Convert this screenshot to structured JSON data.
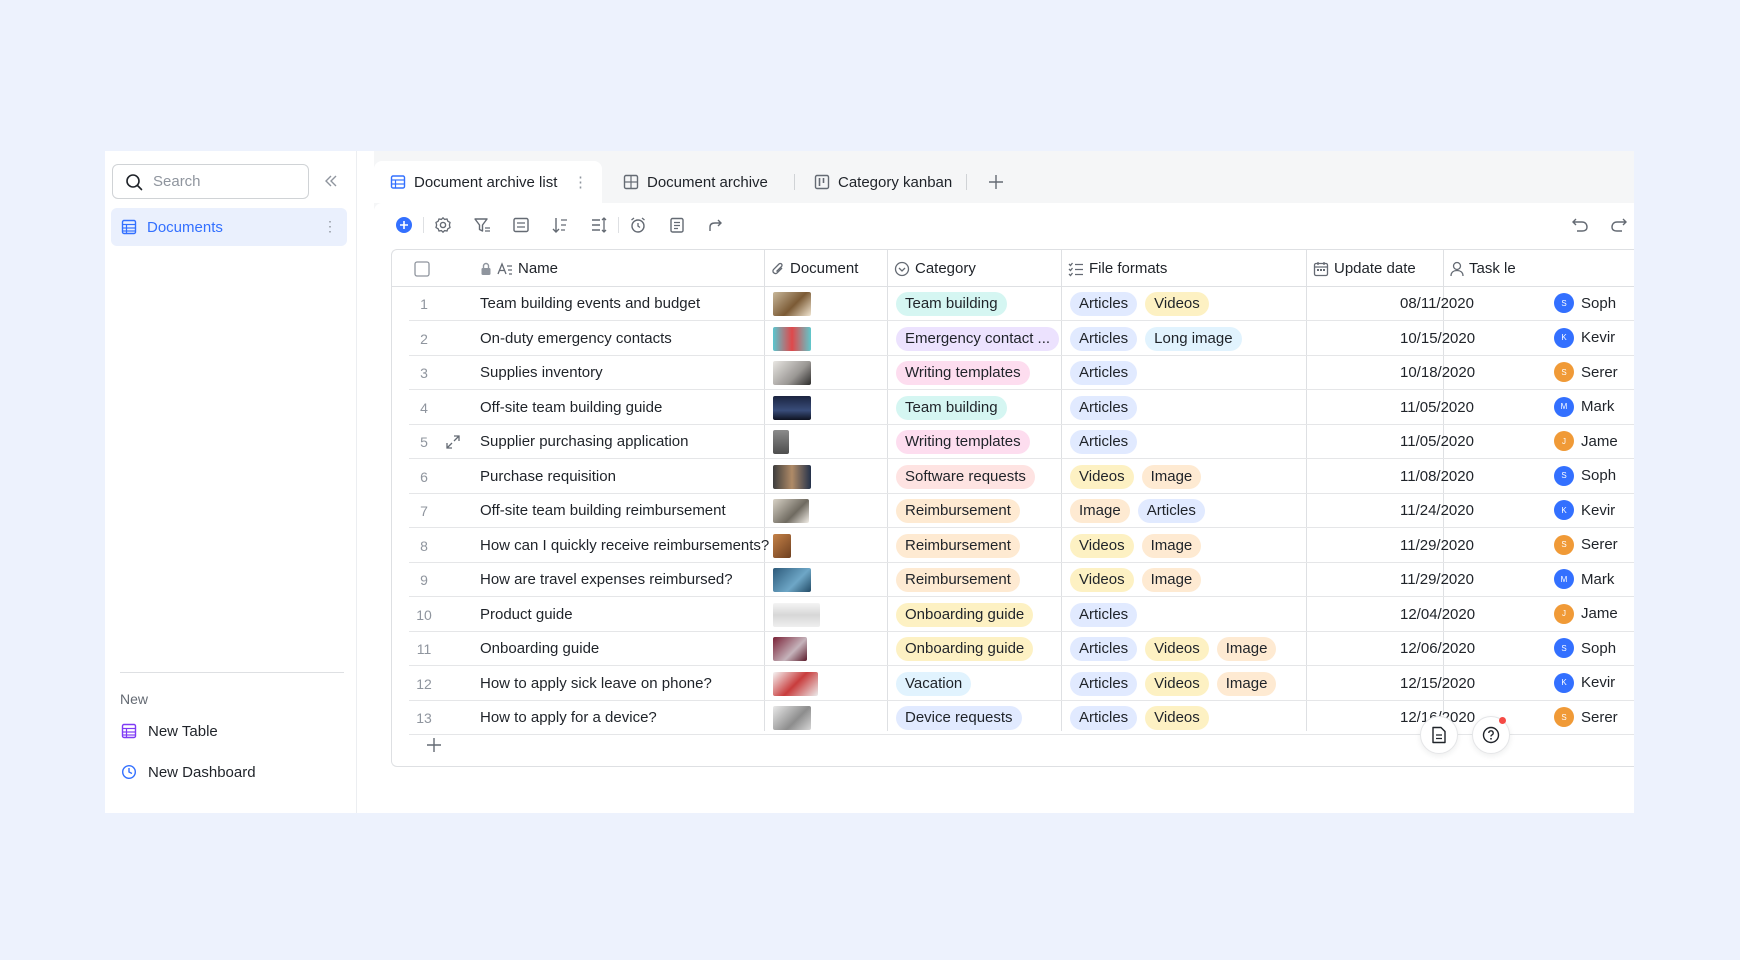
{
  "sidebar": {
    "search_placeholder": "Search",
    "nav_item": "Documents",
    "section_label": "New",
    "new_table": "New Table",
    "new_dashboard": "New Dashboard"
  },
  "tabs": [
    {
      "label": "Document archive list",
      "icon": "grid-table-icon",
      "active": true
    },
    {
      "label": "Document archive",
      "icon": "gallery-icon",
      "active": false
    },
    {
      "label": "Category kanban",
      "icon": "kanban-icon",
      "active": false
    }
  ],
  "columns": {
    "name": "Name",
    "document": "Document",
    "category": "Category",
    "file_formats": "File formats",
    "update_date": "Update date",
    "task_lead": "Task le"
  },
  "rows": [
    {
      "num": "1",
      "name": "Team building events and budget",
      "category": "Team building",
      "formats": [
        "Articles",
        "Videos"
      ],
      "date": "08/11/2020",
      "person": "Soph",
      "initial": "S"
    },
    {
      "num": "2",
      "name": "On-duty emergency contacts",
      "category": "Emergency contact ...",
      "formats": [
        "Articles",
        "Long image"
      ],
      "date": "10/15/2020",
      "person": "Kevir",
      "initial": "K"
    },
    {
      "num": "3",
      "name": "Supplies inventory",
      "category": "Writing templates",
      "formats": [
        "Articles"
      ],
      "date": "10/18/2020",
      "person": "Serer",
      "initial": "S"
    },
    {
      "num": "4",
      "name": "Off-site team building guide",
      "category": "Team building",
      "formats": [
        "Articles"
      ],
      "date": "11/05/2020",
      "person": "Mark",
      "initial": "M"
    },
    {
      "num": "5",
      "name": "Supplier purchasing application",
      "category": "Writing templates",
      "formats": [
        "Articles"
      ],
      "date": "11/05/2020",
      "person": "Jame",
      "initial": "J"
    },
    {
      "num": "6",
      "name": "Purchase requisition",
      "category": "Software requests",
      "formats": [
        "Videos",
        "Image"
      ],
      "date": "11/08/2020",
      "person": "Soph",
      "initial": "S"
    },
    {
      "num": "7",
      "name": "Off-site team building reimbursement",
      "category": "Reimbursement",
      "formats": [
        "Image",
        "Articles"
      ],
      "date": "11/24/2020",
      "person": "Kevir",
      "initial": "K"
    },
    {
      "num": "8",
      "name": "How can I quickly receive reimbursements?",
      "category": "Reimbursement",
      "formats": [
        "Videos",
        "Image"
      ],
      "date": "11/29/2020",
      "person": "Serer",
      "initial": "S"
    },
    {
      "num": "9",
      "name": "How are travel expenses reimbursed?",
      "category": "Reimbursement",
      "formats": [
        "Videos",
        "Image"
      ],
      "date": "11/29/2020",
      "person": "Mark",
      "initial": "M"
    },
    {
      "num": "10",
      "name": "Product guide",
      "category": "Onboarding guide",
      "formats": [
        "Articles"
      ],
      "date": "12/04/2020",
      "person": "Jame",
      "initial": "J"
    },
    {
      "num": "11",
      "name": "Onboarding guide",
      "category": "Onboarding guide",
      "formats": [
        "Articles",
        "Videos",
        "Image"
      ],
      "date": "12/06/2020",
      "person": "Soph",
      "initial": "S"
    },
    {
      "num": "12",
      "name": "How to apply sick leave on phone?",
      "category": "Vacation",
      "formats": [
        "Articles",
        "Videos",
        "Image"
      ],
      "date": "12/15/2020",
      "person": "Kevir",
      "initial": "K"
    },
    {
      "num": "13",
      "name": "How to apply for a device?",
      "category": "Device requests",
      "formats": [
        "Articles",
        "Videos"
      ],
      "date": "12/16/2020",
      "person": "Serer",
      "initial": "S"
    }
  ],
  "category_colors": {
    "Team building": "#d5f6f2",
    "Emergency contact ...": "#ece2fe",
    "Writing templates": "#fdddef",
    "Software requests": "#fee3e2",
    "Reimbursement": "#feead2",
    "Onboarding guide": "#fdf1c3",
    "Vacation": "#e1f3fe",
    "Device requests": "#e1eaff"
  },
  "format_colors": {
    "Articles": "#e1eaff",
    "Videos": "#fdf1c3",
    "Image": "#feead2",
    "Long image": "#e1f3fe"
  },
  "avatar_colors": {
    "S": "#3370ff",
    "K": "#3370ff",
    "M": "#3370ff",
    "J": "#f09a37",
    "Serer": "#f09a37"
  }
}
